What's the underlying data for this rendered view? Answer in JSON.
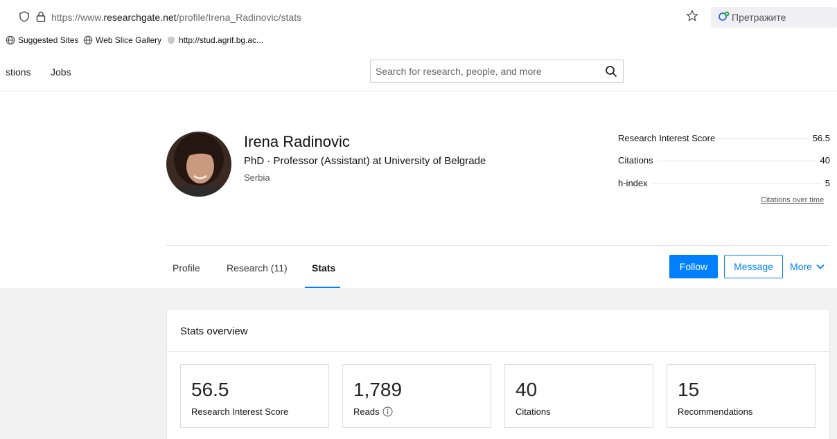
{
  "browser": {
    "url_prefix": "https://www.",
    "url_domain": "researchgate.net",
    "url_path": "/profile/Irena_Radinovic/stats",
    "search_label": "Претражите",
    "bookmarks": [
      "Suggested Sites",
      "Web Slice Gallery",
      "http://stud.agrif.bg.ac..."
    ]
  },
  "site": {
    "nav": [
      "stions",
      "Jobs"
    ],
    "search_placeholder": "Search for research, people, and more"
  },
  "profile": {
    "name": "Irena Radinovic",
    "position": "PhD · Professor (Assistant) at University of Belgrade",
    "country": "Serbia",
    "metrics": [
      {
        "label": "Research Interest Score",
        "value": "56.5"
      },
      {
        "label": "Citations",
        "value": "40"
      },
      {
        "label": "h-index",
        "value": "5"
      }
    ],
    "citations_over_time": "Citations over time"
  },
  "tabs": [
    "Profile",
    "Research (11)",
    "Stats"
  ],
  "actions": {
    "follow": "Follow",
    "message": "Message",
    "more": "More"
  },
  "stats": {
    "title": "Stats overview",
    "items": [
      {
        "value": "56.5",
        "label": "Research Interest Score"
      },
      {
        "value": "1,789",
        "label": "Reads"
      },
      {
        "value": "40",
        "label": "Citations"
      },
      {
        "value": "15",
        "label": "Recommendations"
      }
    ]
  },
  "colors": {
    "accent": "#0080ff",
    "background_gray": "#f2f2f2"
  }
}
